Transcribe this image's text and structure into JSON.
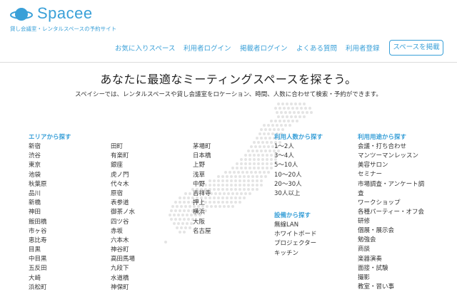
{
  "brand": {
    "name": "Spacee",
    "tagline": "貸し会議室・レンタルスペースの予約サイト",
    "color": "#3aa0d8"
  },
  "nav": {
    "items": [
      "お気に入りスペース",
      "利用者ログイン",
      "掲載者ログイン",
      "よくある質問",
      "利用者登録"
    ],
    "cta": "スペースを掲載"
  },
  "hero": {
    "headline": "あなたに最適なミーティングスペースを探そう。",
    "subline": "スペイシーでは、レンタルスペースや貸し会議室をロケーション、時間、人数に合わせて検索・予約ができます。"
  },
  "areas": {
    "heading": "エリアから探す",
    "col1": [
      "新宿",
      "渋谷",
      "東京",
      "池袋",
      "秋葉原",
      "品川",
      "新橋",
      "神田",
      "飯田橋",
      "市ヶ谷",
      "恵比寿",
      "目黒",
      "中目黒",
      "五反田",
      "大崎",
      "浜松町"
    ],
    "col2": [
      "田町",
      "有楽町",
      "銀座",
      "虎ノ門",
      "代々木",
      "原宿",
      "表参道",
      "御茶ノ水",
      "四ツ谷",
      "赤坂",
      "六本木",
      "神谷町",
      "高田馬場",
      "九段下",
      "水道橋",
      "神保町"
    ],
    "col3": [
      "茅場町",
      "日本橋",
      "上野",
      "浅草",
      "中野",
      "吉祥寺",
      "押上",
      "横浜",
      "大阪",
      "名古屋"
    ]
  },
  "capacity": {
    "heading": "利用人数から探す",
    "items": [
      "1〜2人",
      "3〜4人",
      "5〜10人",
      "10〜20人",
      "20〜30人",
      "30人以上"
    ]
  },
  "equipment": {
    "heading": "設備から探す",
    "items": [
      "無線LAN",
      "ホワイトボード",
      "プロジェクター",
      "キッチン"
    ]
  },
  "purpose": {
    "heading": "利用用途から探す",
    "items": [
      "会議・打ち合わせ",
      "マンツーマンレッスン",
      "美容サロン",
      "セミナー",
      "市場調査・アンケート調査",
      "ワークショップ",
      "各種パーティー・オフ会",
      "研修",
      "個展・展示会",
      "勉強会",
      "商談",
      "楽器演奏",
      "面接・試験",
      "撮影",
      "教室・習い事"
    ]
  }
}
